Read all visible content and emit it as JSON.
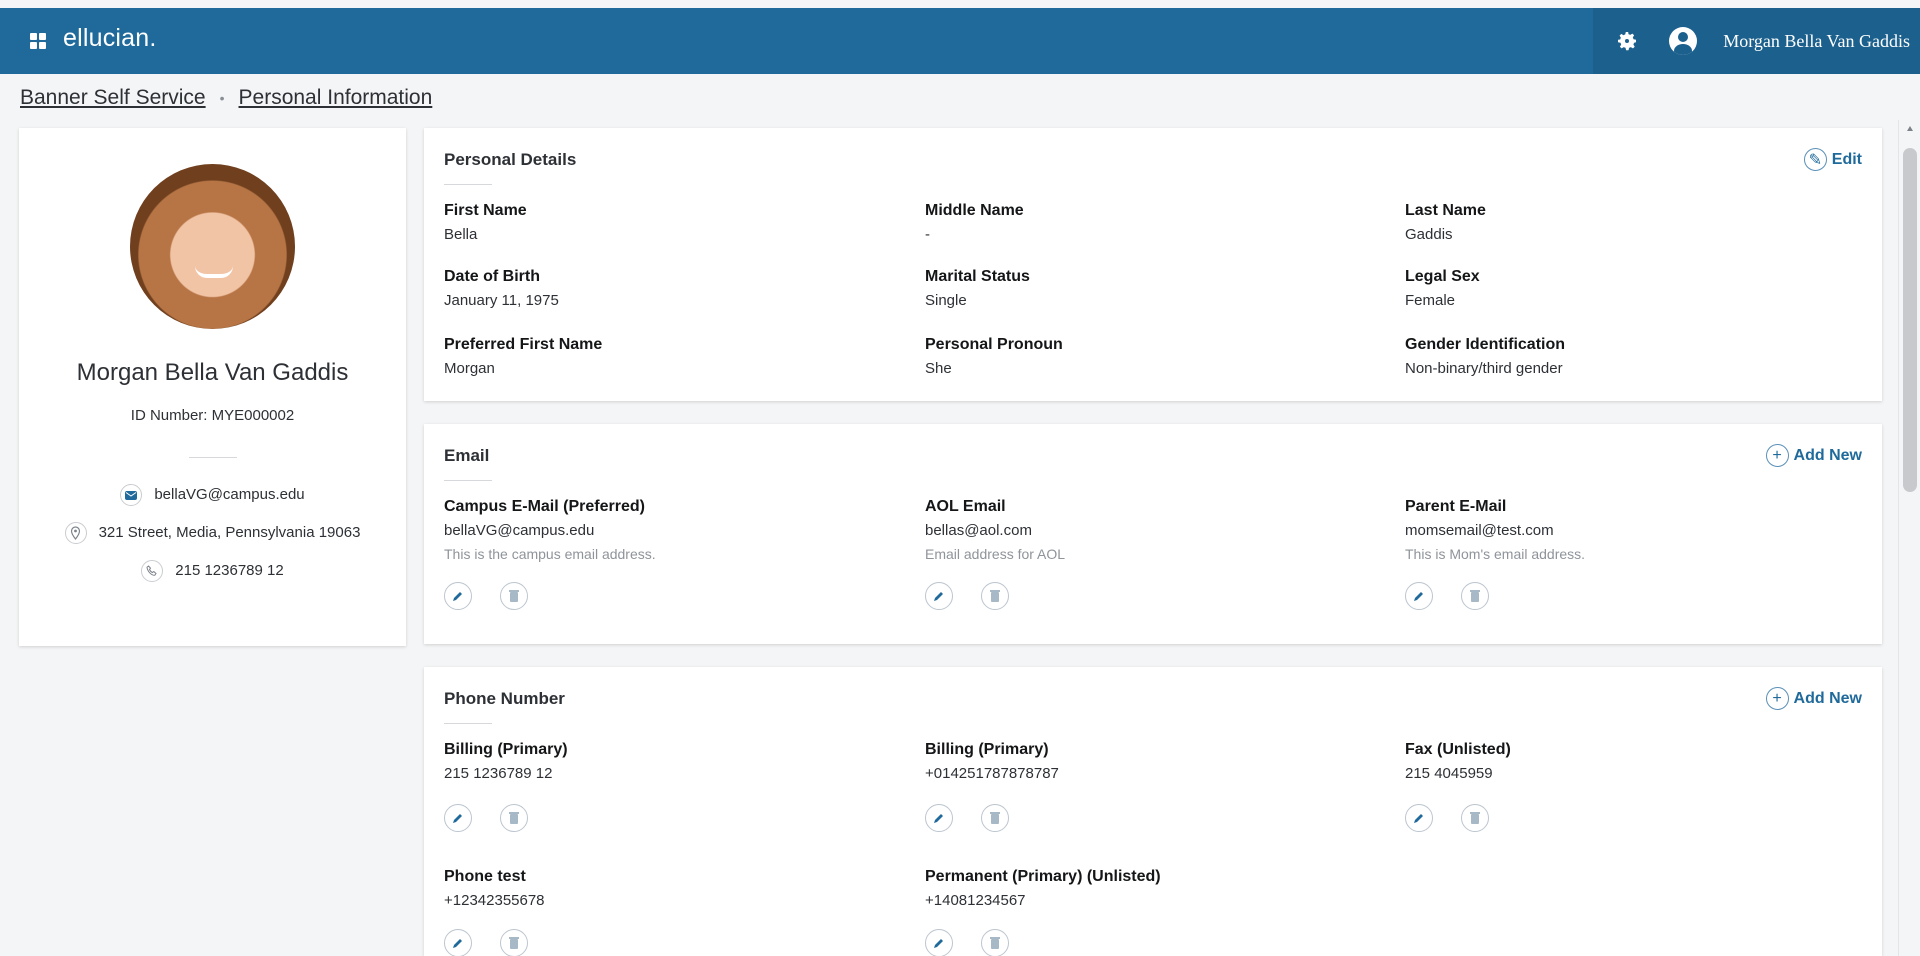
{
  "header": {
    "brand": "ellucian.",
    "user_name": "Morgan Bella Van Gaddis",
    "icons": [
      "grid-icon",
      "gear-icon",
      "user-icon"
    ],
    "accent": "#1f6a9b"
  },
  "breadcrumb": {
    "home": "Banner Self Service",
    "current": "Personal Information"
  },
  "profile": {
    "name": "Morgan Bella Van Gaddis",
    "id_label": "ID Number: MYE000002",
    "email": "bellaVG@campus.edu",
    "address": "321 Street, Media, Pennsylvania 19063",
    "phone": "215 1236789 12"
  },
  "personal_details": {
    "title": "Personal Details",
    "action": "Edit",
    "fields": [
      {
        "label": "First Name",
        "value": "Bella"
      },
      {
        "label": "Middle Name",
        "value": "-"
      },
      {
        "label": "Last Name",
        "value": "Gaddis"
      },
      {
        "label": "Date of Birth",
        "value": "January 11, 1975"
      },
      {
        "label": "Marital Status",
        "value": "Single"
      },
      {
        "label": "Legal Sex",
        "value": "Female"
      },
      {
        "label": "Preferred First Name",
        "value": "Morgan"
      },
      {
        "label": "Personal Pronoun",
        "value": "She"
      },
      {
        "label": "Gender Identification",
        "value": "Non-binary/third gender"
      }
    ]
  },
  "email": {
    "title": "Email",
    "action": "Add New",
    "items": [
      {
        "label": "Campus E-Mail (Preferred)",
        "value": "bellaVG@campus.edu",
        "desc": "This is the campus email address."
      },
      {
        "label": "AOL Email",
        "value": "bellas@aol.com",
        "desc": "Email address for AOL"
      },
      {
        "label": "Parent E-Mail",
        "value": "momsemail@test.com",
        "desc": "This is Mom's email address."
      }
    ]
  },
  "phone": {
    "title": "Phone Number",
    "action": "Add New",
    "items": [
      {
        "label": "Billing (Primary)",
        "value": "215 1236789 12"
      },
      {
        "label": "Billing (Primary)",
        "value": "+014251787878787"
      },
      {
        "label": "Fax (Unlisted)",
        "value": "215 4045959"
      },
      {
        "label": "Phone test",
        "value": "+12342355678"
      },
      {
        "label": "Permanent (Primary) (Unlisted)",
        "value": "+14081234567"
      }
    ]
  }
}
